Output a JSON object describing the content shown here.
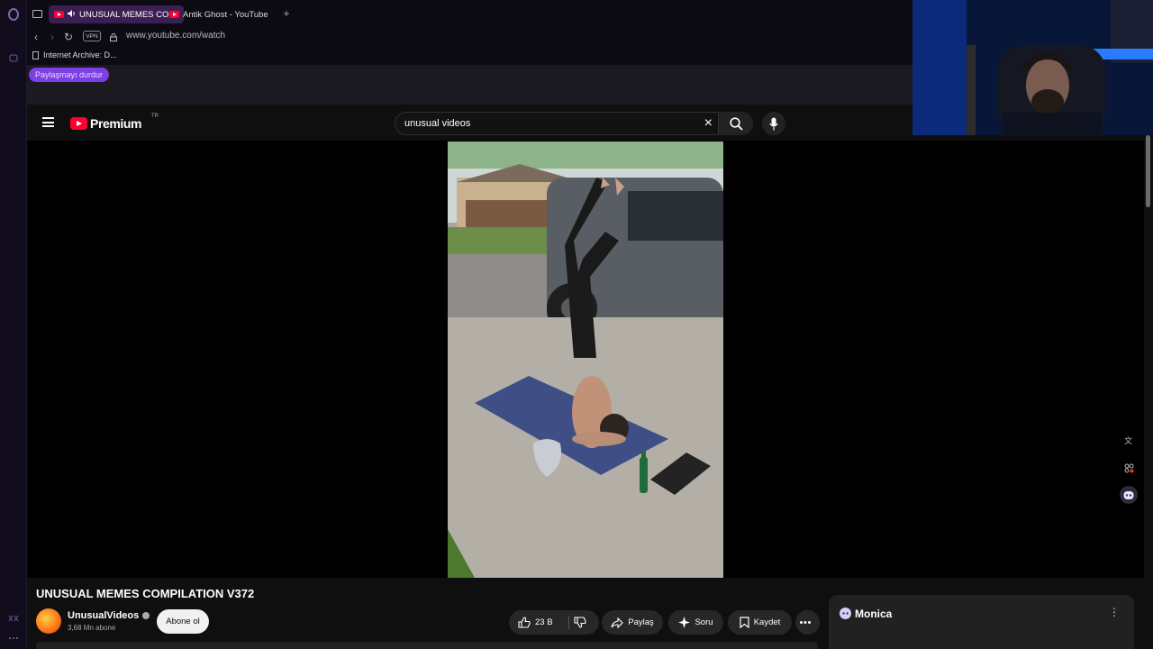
{
  "browser": {
    "tabs": [
      {
        "label": "UNUSUAL MEMES CO",
        "active": true
      },
      {
        "label": "Antik Ghost - YouTube",
        "active": false
      }
    ],
    "new_tab_label": "+",
    "url": "www.youtube.com/watch",
    "vpn_label": "VPN",
    "bookmarks": [
      {
        "label": "Internet Archive: D..."
      }
    ],
    "share_stop_label": "Paylaşmayı durdur"
  },
  "youtube": {
    "logo_text": "Premium",
    "region_code": "TR",
    "search": {
      "value": "unusual videos"
    }
  },
  "video": {
    "title": "UNUSUAL MEMES COMPILATION V372",
    "channel": {
      "name": "UnusualVideos",
      "subscribers": "3,68 Mn abone"
    },
    "subscribe_label": "Abone ol",
    "actions": {
      "likes": "23 B",
      "share": "Paylaş",
      "ask": "Soru",
      "save": "Kaydet"
    }
  },
  "monica": {
    "title": "Monica"
  },
  "colors": {
    "brand_red": "#ff0033",
    "opera_purple": "#7b3fe4",
    "background": "#0f0f0f"
  }
}
